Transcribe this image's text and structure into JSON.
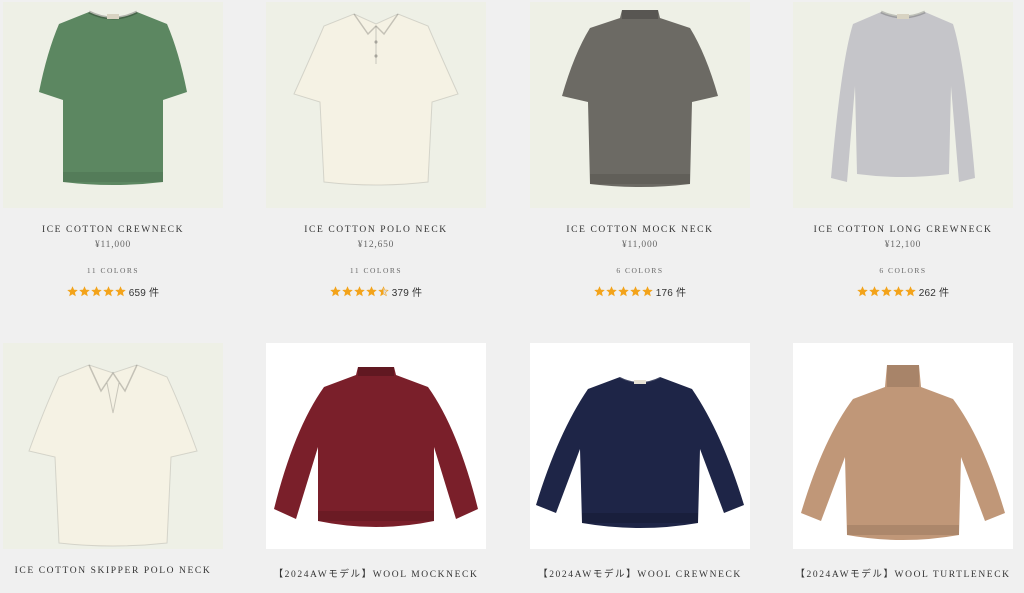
{
  "colors": {
    "page_bg": "#f0f0f0",
    "star": "#f3a31a",
    "star_empty": "#dddddd"
  },
  "products": [
    {
      "name": "ICE COTTON CREWNECK",
      "price": "¥11,000",
      "colors_label": "11 COLORS",
      "rating": 5,
      "review_count": "659 件",
      "garment": "crewneck-tee",
      "garment_color": "#5c8761"
    },
    {
      "name": "ICE COTTON POLO NECK",
      "price": "¥12,650",
      "colors_label": "11 COLORS",
      "rating": 4.5,
      "review_count": "379 件",
      "garment": "polo",
      "garment_color": "#f5f2e4"
    },
    {
      "name": "ICE COTTON MOCK NECK",
      "price": "¥11,000",
      "colors_label": "6 COLORS",
      "rating": 5,
      "review_count": "176 件",
      "garment": "mock-tee",
      "garment_color": "#6c6a64"
    },
    {
      "name": "ICE COTTON LONG CREWNECK",
      "price": "¥12,100",
      "colors_label": "6 COLORS",
      "rating": 5,
      "review_count": "262 件",
      "garment": "long-crew",
      "garment_color": "#c5c5c9"
    },
    {
      "name": "ICE COTTON SKIPPER POLO NECK",
      "garment": "skipper",
      "garment_color": "#f5f2e4"
    },
    {
      "name": "【2024AWモデル】WOOL MOCKNECK",
      "garment": "mock-sweater",
      "garment_color": "#7a1f2a"
    },
    {
      "name": "【2024AWモデル】WOOL CREWNECK",
      "garment": "crew-sweater",
      "garment_color": "#1e2547"
    },
    {
      "name": "【2024AWモデル】WOOL TURTLENECK",
      "garment": "turtle-sweater",
      "garment_color": "#c09778"
    }
  ]
}
